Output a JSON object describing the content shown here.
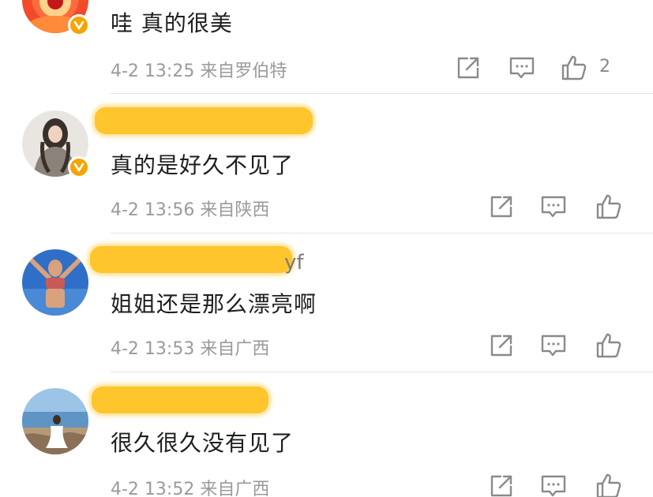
{
  "comments": [
    {
      "text": "哇 真的很美",
      "meta": "4-2 13:25 来自罗伯特",
      "likes": "2",
      "name_suffix": ""
    },
    {
      "text": "真的是好久不见了",
      "meta": "4-2 13:56 来自陕西",
      "likes": "",
      "name_suffix": ""
    },
    {
      "text": "姐姐还是那么漂亮啊",
      "meta": "4-2 13:53 来自广西",
      "likes": "",
      "name_suffix": "yf"
    },
    {
      "text": "很久很久没有见了",
      "meta": "4-2 13:52 来自广西",
      "likes": "",
      "name_suffix": ""
    }
  ],
  "icons": {
    "share": "share-icon",
    "reply": "comment-icon",
    "like": "thumbs-up-icon",
    "verified": "verified-badge-icon"
  },
  "colors": {
    "redaction": "#ffc52c",
    "verified": "#f6a400",
    "meta_text": "#9a9a9a"
  }
}
